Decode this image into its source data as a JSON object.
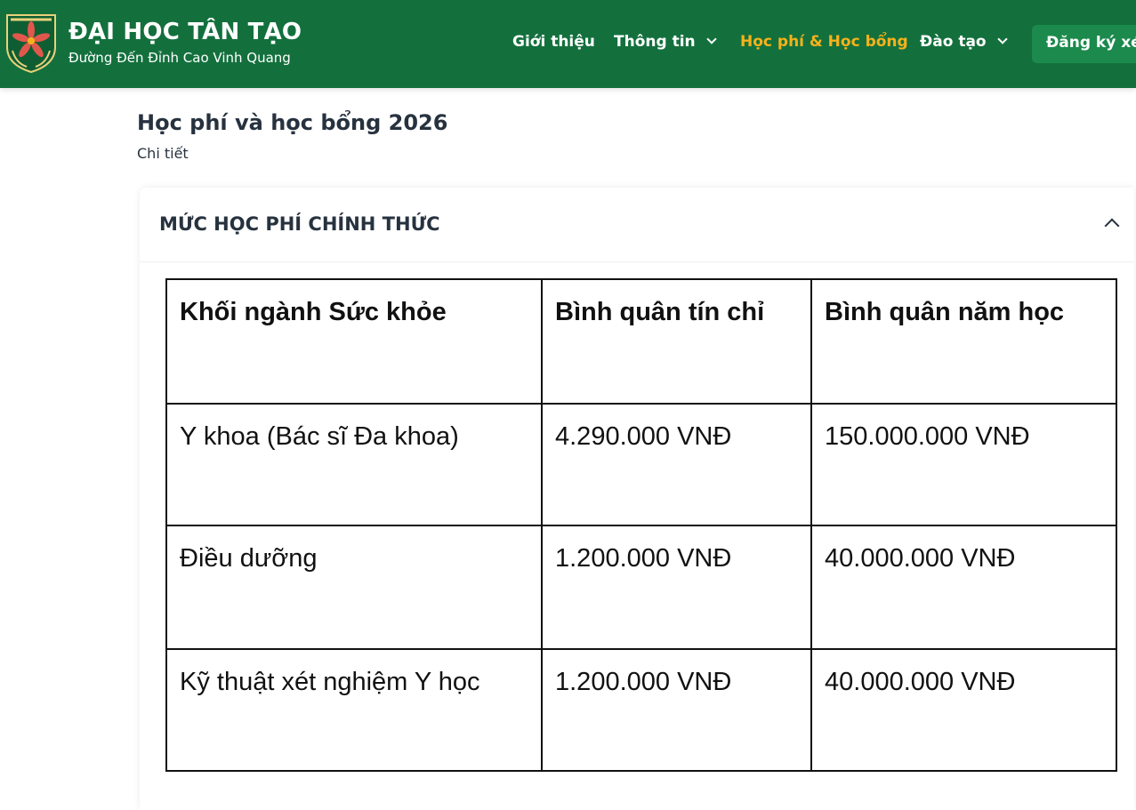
{
  "header": {
    "brand_title": "ĐẠI HỌC TÂN TẠO",
    "brand_subtitle": "Đường Đến Đỉnh Cao Vinh Quang",
    "logo_icon": "ttu-seal-logo",
    "nav": [
      {
        "label": "Giới thiệu",
        "has_dropdown": false
      },
      {
        "label": "Thông tin",
        "has_dropdown": true
      },
      {
        "label": "Học phí & Học bổng",
        "has_dropdown": false,
        "active": true
      },
      {
        "label": "Đào tạo",
        "has_dropdown": true
      }
    ],
    "register_label": "Đăng ký xét tuyển",
    "colors": {
      "background": "#13703d",
      "active": "#f5b21b",
      "button": "#1b8a4c"
    }
  },
  "page": {
    "title": "Học phí và học bổng 2026",
    "subtitle": "Chi tiết"
  },
  "accordion": {
    "title": "MỨC HỌC PHÍ CHÍNH THỨC",
    "expanded": true,
    "toggle_icon": "chevron-up-icon"
  },
  "fee_table": {
    "headers": [
      "Khối ngành Sức khỏe",
      "Bình quân tín chỉ",
      "Bình quân năm học"
    ],
    "rows": [
      [
        "Y khoa (Bác sĩ Đa khoa)",
        "4.290.000 VNĐ",
        "150.000.000 VNĐ"
      ],
      [
        "Điều dưỡng",
        "1.200.000 VNĐ",
        "40.000.000 VNĐ"
      ],
      [
        "Kỹ thuật xét nghiệm Y học",
        "1.200.000 VNĐ",
        "40.000.000 VNĐ"
      ]
    ]
  }
}
